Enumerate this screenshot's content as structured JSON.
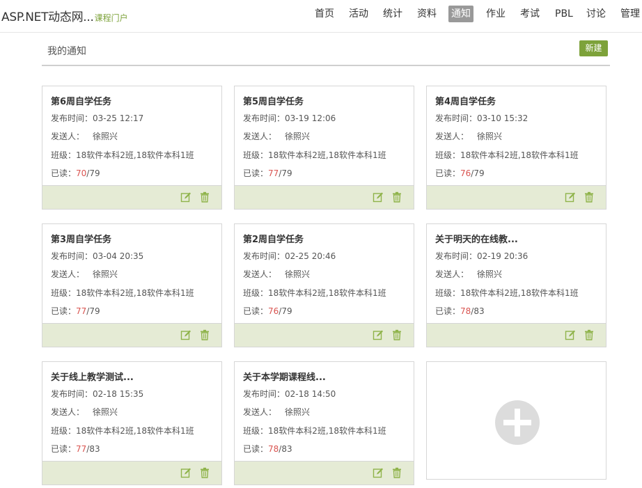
{
  "header": {
    "title": "ASP.NET动态网...",
    "subtitle": "课程门户",
    "nav": [
      {
        "label": "首页"
      },
      {
        "label": "活动"
      },
      {
        "label": "统计"
      },
      {
        "label": "资料"
      },
      {
        "label": "通知",
        "active": true
      },
      {
        "label": "作业"
      },
      {
        "label": "考试"
      },
      {
        "label": "PBL"
      },
      {
        "label": "讨论"
      },
      {
        "label": "管理"
      }
    ]
  },
  "section": {
    "title": "我的通知",
    "new_button": "新建"
  },
  "labels": {
    "publish_time": "发布时间：",
    "sender": "发送人：",
    "class": "班级：",
    "read": "已读："
  },
  "notices": [
    {
      "title": "第6周自学任务",
      "time": "03-25 12:17",
      "sender": "徐照兴",
      "classes": "18软件本科2班,18软件本科1班",
      "read": "70",
      "total": "/79"
    },
    {
      "title": "第5周自学任务",
      "time": "03-19 12:06",
      "sender": "徐照兴",
      "classes": "18软件本科2班,18软件本科1班",
      "read": "77",
      "total": "/79"
    },
    {
      "title": "第4周自学任务",
      "time": "03-10 15:32",
      "sender": "徐照兴",
      "classes": "18软件本科2班,18软件本科1班",
      "read": "76",
      "total": "/79"
    },
    {
      "title": "第3周自学任务",
      "time": "03-04 20:35",
      "sender": "徐照兴",
      "classes": "18软件本科2班,18软件本科1班",
      "read": "77",
      "total": "/79"
    },
    {
      "title": "第2周自学任务",
      "time": "02-25 20:46",
      "sender": "徐照兴",
      "classes": "18软件本科2班,18软件本科1班",
      "read": "76",
      "total": "/79"
    },
    {
      "title": "关于明天的在线教...",
      "time": "02-19 20:36",
      "sender": "徐照兴",
      "classes": "18软件本科2班,18软件本科1班",
      "read": "78",
      "total": "/83"
    },
    {
      "title": "关于线上教学测试...",
      "time": "02-18 15:35",
      "sender": "徐照兴",
      "classes": "18软件本科2班,18软件本科1班",
      "read": "77",
      "total": "/83"
    },
    {
      "title": "关于本学期课程线...",
      "time": "02-18 14:50",
      "sender": "徐照兴",
      "classes": "18软件本科2班,18软件本科1班",
      "read": "78",
      "total": "/83"
    }
  ],
  "colors": {
    "accent": "#7da23a",
    "footer_bg": "#e5ebd5",
    "read_highlight": "#d9534f",
    "add_circle": "#dcdcdc"
  },
  "icons": {
    "edit": "edit-icon",
    "delete": "trash-icon",
    "add": "plus-icon"
  }
}
